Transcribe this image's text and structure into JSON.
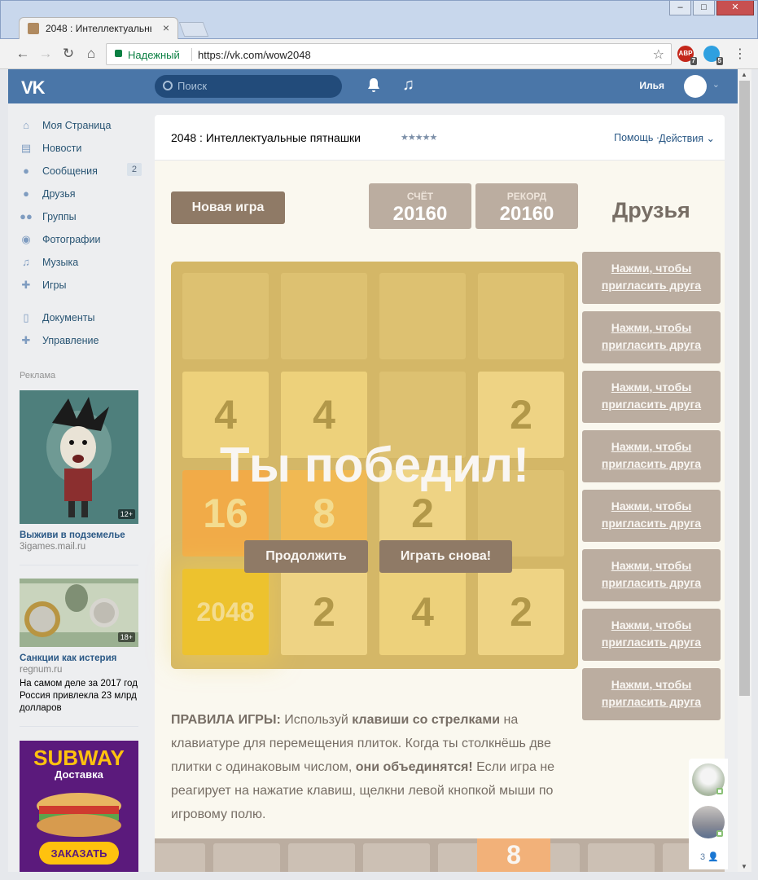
{
  "browser": {
    "tab_title": "2048 : Интеллектуальны",
    "secure_label": "Надежный",
    "url": "https://vk.com/wow2048",
    "ext1_badge": "7",
    "ext2_badge": "5",
    "ext1_text": "ABP"
  },
  "vk": {
    "search_placeholder": "Поиск",
    "user_name": "Илья"
  },
  "nav": {
    "items": [
      {
        "label": "Моя Страница",
        "icon": "home-icon"
      },
      {
        "label": "Новости",
        "icon": "news-icon"
      },
      {
        "label": "Сообщения",
        "icon": "messages-icon",
        "badge": "2"
      },
      {
        "label": "Друзья",
        "icon": "friends-icon"
      },
      {
        "label": "Группы",
        "icon": "groups-icon"
      },
      {
        "label": "Фотографии",
        "icon": "photos-icon"
      },
      {
        "label": "Музыка",
        "icon": "music-icon"
      },
      {
        "label": "Игры",
        "icon": "games-icon"
      }
    ],
    "items2": [
      {
        "label": "Документы",
        "icon": "documents-icon"
      },
      {
        "label": "Управление",
        "icon": "manage-icon"
      }
    ]
  },
  "ads": {
    "title": "Реклама",
    "ad1": {
      "title": "Выживи в подземелье",
      "domain": "3igames.mail.ru",
      "age": "12+"
    },
    "ad2": {
      "title": "Санкции как истерия",
      "domain": "regnum.ru",
      "text": "На самом деле за 2017 год Россия привлекла 23 млрд долларов",
      "age": "18+"
    },
    "ad3": {
      "brand": "SUBWAY",
      "sub": "Доставка",
      "cta": "ЗАКАЗАТЬ"
    }
  },
  "app": {
    "title": "2048 : Интеллектуальные пятнашки",
    "stars": "★★★★★",
    "help": "Помощь ·",
    "actions": "Действия ⌄"
  },
  "game": {
    "new_game": "Новая игра",
    "score_label": "СЧЁТ",
    "score_value": "20160",
    "best_label": "РЕКОРД",
    "best_value": "20160",
    "friends_title": "Друзья",
    "win_message": "Ты победил!",
    "continue_label": "Продолжить",
    "play_again_label": "Играть снова!",
    "board": [
      [
        "",
        "",
        "",
        ""
      ],
      [
        "4",
        "4",
        "",
        "2"
      ],
      [
        "16",
        "8",
        "2",
        ""
      ],
      [
        "2048",
        "2",
        "4",
        "2"
      ]
    ],
    "invite_label": "Нажми, чтобы пригласить друга",
    "invite_count": 8,
    "rules_head": "ПРАВИЛА ИГРЫ:",
    "rules_1": " Используй ",
    "rules_keys": "клавиши со стрелками",
    "rules_2": " на клавиатуре для перемещения плиток. Когда ты столкнёшь две плитки с одинаковым числом, ",
    "rules_merge": "они объединятся!",
    "rules_3": " Если игра не реагирует на нажатие клавиш, щелкни левой кнопкой мыши по игровому полю.",
    "strip_tile": "8"
  },
  "chat": {
    "count": "3"
  }
}
